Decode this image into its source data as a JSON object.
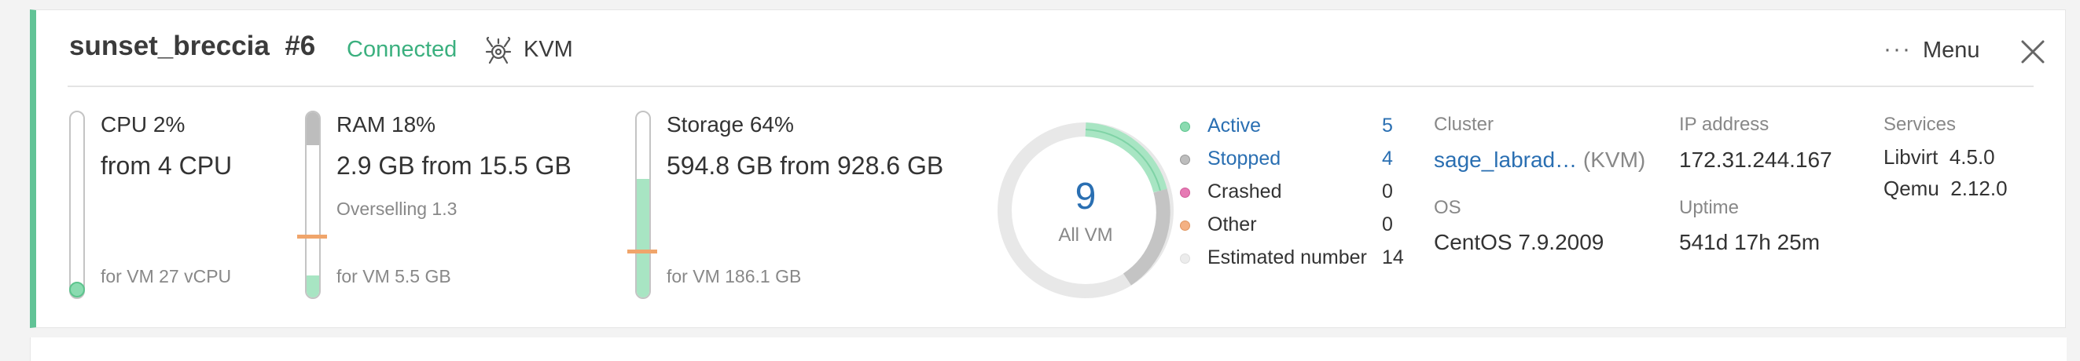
{
  "header": {
    "name": "sunset_breccia",
    "number": "#6",
    "status": "Connected",
    "hypervisor": "KVM",
    "menu_label": "Menu",
    "menu_icon": "ellipsis-icon",
    "close_icon": "close-icon"
  },
  "colors": {
    "accent": "#61c396",
    "link": "#2a6fb2",
    "active": "#8adbb0",
    "stopped": "#bdbdbd",
    "crashed": "#e67ab4",
    "other": "#f4b183",
    "marker": "#f0a56b"
  },
  "cpu": {
    "title": "CPU 2%",
    "value": "from 4 CPU",
    "footer": "for VM 27 vCPU",
    "usage_percent": 2
  },
  "ram": {
    "title": "RAM 18%",
    "value": "2.9 GB from 15.5 GB",
    "overselling": "Overselling 1.3",
    "footer": "for VM 5.5 GB",
    "vm_fill_percent": 12,
    "used_percent": 18
  },
  "storage": {
    "title": "Storage 64%",
    "value": "594.8 GB from 928.6 GB",
    "footer": "for VM 186.1 GB",
    "fill_percent": 64
  },
  "vms": {
    "total": "9",
    "total_label": "All VM",
    "legend": [
      {
        "label": "Active",
        "value": "5",
        "color": "#8adbb0",
        "link": true
      },
      {
        "label": "Stopped",
        "value": "4",
        "color": "#bdbdbd",
        "link": true
      },
      {
        "label": "Crashed",
        "value": "0",
        "color": "#e67ab4",
        "link": false
      },
      {
        "label": "Other",
        "value": "0",
        "color": "#f4b183",
        "link": false
      },
      {
        "label": "Estimated number",
        "value": "14",
        "color": "#e8e8e8",
        "link": false
      }
    ]
  },
  "info": {
    "cluster_label": "Cluster",
    "cluster_value": "sage_labrad…",
    "cluster_type": "(KVM)",
    "os_label": "OS",
    "os_value": "CentOS 7.9.2009",
    "ip_label": "IP address",
    "ip_value": "172.31.244.167",
    "uptime_label": "Uptime",
    "uptime_value": "541d 17h 25m",
    "services_label": "Services",
    "services": [
      {
        "name": "Libvirt",
        "version": "4.5.0"
      },
      {
        "name": "Qemu",
        "version": "2.12.0"
      }
    ]
  }
}
